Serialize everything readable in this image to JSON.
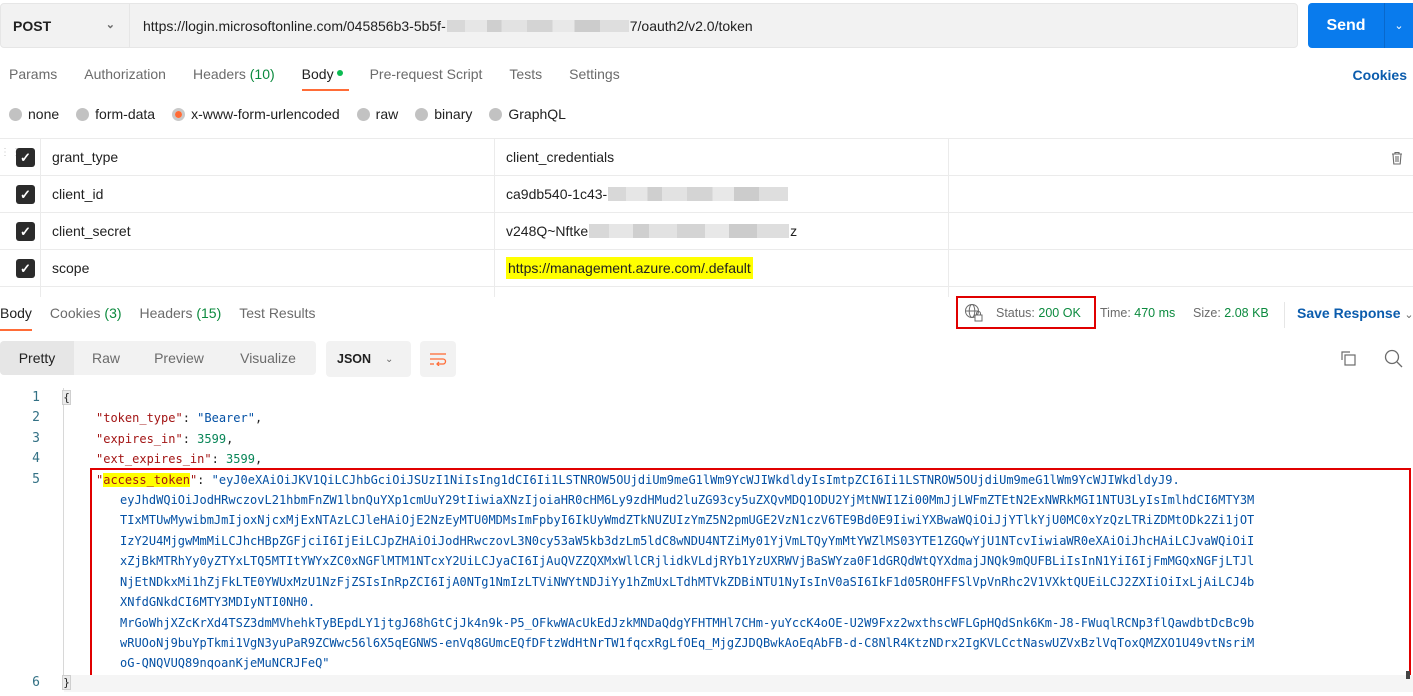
{
  "request": {
    "method": "POST",
    "url_prefix": "https://login.microsoftonline.com/045856b3-5b5f-",
    "url_suffix": "7/oauth2/v2.0/token",
    "send_label": "Send"
  },
  "request_tabs": [
    {
      "label": "Params"
    },
    {
      "label": "Authorization"
    },
    {
      "label": "Headers",
      "count": "(10)"
    },
    {
      "label": "Body",
      "active": true
    },
    {
      "label": "Pre-request Script"
    },
    {
      "label": "Tests"
    },
    {
      "label": "Settings"
    }
  ],
  "cookies_link": "Cookies",
  "body_types": [
    {
      "label": "none"
    },
    {
      "label": "form-data"
    },
    {
      "label": "x-www-form-urlencoded",
      "selected": true
    },
    {
      "label": "raw"
    },
    {
      "label": "binary"
    },
    {
      "label": "GraphQL"
    }
  ],
  "params": [
    {
      "key": "grant_type",
      "value": "client_credentials",
      "checked": true
    },
    {
      "key": "client_id",
      "value_prefix": "ca9db540-1c43-",
      "value_suffix": "",
      "checked": true
    },
    {
      "key": "client_secret",
      "value_prefix": "v248Q~Nftke",
      "value_suffix": "z",
      "checked": true
    },
    {
      "key": "scope",
      "value": "https://management.azure.com/.default",
      "checked": true
    }
  ],
  "response_tabs": [
    {
      "label": "Body",
      "active": true
    },
    {
      "label": "Cookies",
      "count": "(3)"
    },
    {
      "label": "Headers",
      "count": "(15)"
    },
    {
      "label": "Test Results"
    }
  ],
  "response_meta": {
    "status_label": "Status:",
    "status_value": "200 OK",
    "time_label": "Time:",
    "time_value": "470 ms",
    "size_label": "Size:",
    "size_value": "2.08 KB",
    "save_response": "Save Response"
  },
  "view_modes": [
    {
      "label": "Pretty",
      "active": true
    },
    {
      "label": "Raw"
    },
    {
      "label": "Preview"
    },
    {
      "label": "Visualize"
    }
  ],
  "format": "JSON",
  "response_json": {
    "line_numbers": [
      "1",
      "2",
      "3",
      "4",
      "5",
      "6"
    ],
    "open_brace": "{",
    "close_brace": "}",
    "token_type_key": "\"token_type\"",
    "token_type_value": "\"Bearer\"",
    "expires_in_key": "\"expires_in\"",
    "expires_in_value": "3599",
    "ext_expires_in_key": "\"ext_expires_in\"",
    "ext_expires_in_value": "3599",
    "access_token_key": "access_token",
    "access_token_lines": [
      "\"eyJ0eXAiOiJKV1QiLCJhbGciOiJSUzI1NiIsIng1dCI6Ii1LSTNROW5OUjdiUm9meG1lWm9YcWJIWkdldyIsImtpZCI6Ii1LSTNROW5OUjdiUm9meG1lWm9YcWJIWkdldyJ9.",
      "eyJhdWQiOiJodHRwczovL21hbmFnZW1lbnQuYXp1cmUuY29tIiwiaXNzIjoiaHR0cHM6Ly9zdHMud2luZG93cy5uZXQvMDQ1ODU2YjMtNWI1Zi00MmJjLWFmZTEtN2ExNWRkMGI1NTU3LyIsImlhdCI6MTY3M",
      "TIxMTUwMywibmJmIjoxNjcxMjExNTAzLCJleHAiOjE2NzEyMTU0MDMsImFpbyI6IkUyWmdZTkNUZUIzYmZ5N2pmUGE2VzN1czV6TE9Bd0E9IiwiYXBwaWQiOiJjYTlkYjU0MC0xYzQzLTRiZDMtODk2Zi1jOT",
      "IzY2U4MjgwMmMiLCJhcHBpZGFjciI6IjEiLCJpZHAiOiJodHRwczovL3N0cy53aW5kb3dzLm5ldC8wNDU4NTZiMy01YjVmLTQyYmMtYWZlMS03YTE1ZGQwYjU1NTcvIiwiaWR0eXAiOiJhcHAiLCJvaWQiOiI",
      "xZjBkMTRhYy0yZTYxLTQ5MTItYWYxZC0xNGFlMTM1NTcxY2UiLCJyaCI6IjAuQVZZQXMxWllCRjlidkVLdjRYb1YzUXRWVjBaSWYza0F1dGRQdWtQYXdmajJNQk9mQUFBLiIsInN1YiI6IjFmMGQxNGFjLTJl",
      "NjEtNDkxMi1hZjFkLTE0YWUxMzU1NzFjZSIsInRpZCI6IjA0NTg1NmIzLTViNWYtNDJiYy1hZmUxLTdhMTVkZDBiNTU1NyIsInV0aSI6IkF1d05ROHFFSlVpVnRhc2V1VXktQUEiLCJ2ZXIiOiIxLjAiLCJ4b",
      "XNfdGNkdCI6MTY3MDIyNTI0NH0.",
      "MrGoWhjXZcKrXd4TSZ3dmMVhehkTyBEpdLY1jtgJ68hGtCjJk4n9k-P5_OFkwWAcUkEdJzkMNDaQdgYFHTMHl7CHm-yuYccK4oOE-U2W9Fxz2wxthscWFLGpHQdSnk6Km-J8-FWuqlRCNp3flQawdbtDcBc9b",
      "wRUOoNj9buYpTkmi1VgN3yuPaR9ZCWwc56l6X5qEGNWS-enVq8GUmcEQfDFtzWdHtNrTW1fqcxRgLfOEq_MjgZJDQBwkAoEqAbFB-d-C8NlR4KtzNDrx2IgKVLCctNaswUZVxBzlVqToxQMZXO1U49vtNsriM",
      "oG-QNQVUQ89nqoanKjeMuNCRJFeQ\""
    ]
  }
}
